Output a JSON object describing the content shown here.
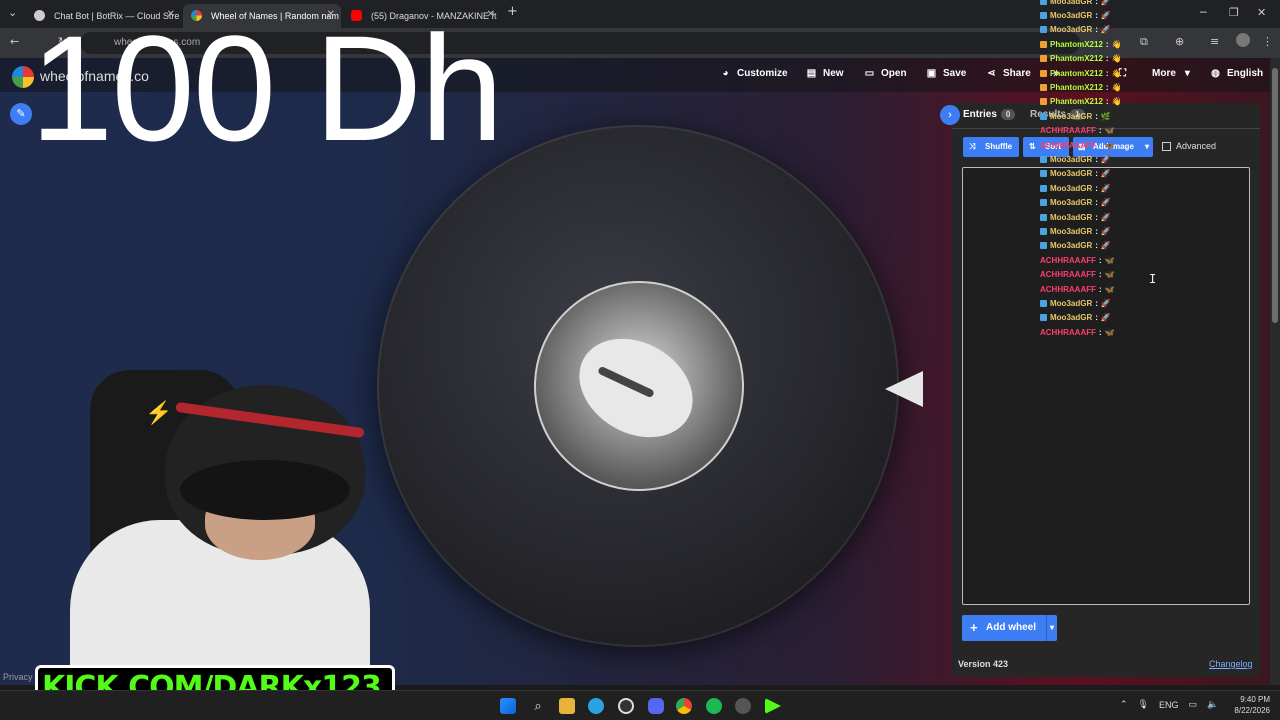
{
  "browser": {
    "tabs": [
      {
        "title": "Chat Bot | BotRix — Cloud Stre",
        "color": "#cccccc"
      },
      {
        "title": "Wheel of Names | Random nam",
        "color": "#e53935"
      },
      {
        "title": "(55) Draganov - MANZAKINE ft",
        "color": "#ff0000"
      }
    ],
    "new_tab": "+",
    "url": "wheelofnames.com"
  },
  "overlay": {
    "big_text": "100 Dh",
    "kick_banner": "KICK.COM/DARKx123"
  },
  "app": {
    "site_name": "wheelofnames.co",
    "toolbar": {
      "customize": "Customize",
      "new": "New",
      "open": "Open",
      "save": "Save",
      "share": "Share",
      "more": "More",
      "language": "English"
    },
    "panel": {
      "entries_tab": "Entries",
      "entries_count": "0",
      "results_tab": "Results",
      "results_count": "1",
      "shuffle": "Shuffle",
      "sort": "Sort",
      "add_image": "Add image",
      "advanced": "Advanced",
      "add_wheel": "Add wheel",
      "version": "Version 423",
      "changelog": "Changelog"
    },
    "privacy": "Privacy"
  },
  "chat": [
    {
      "user": "Moo3adGR",
      "color": "#e6c86b",
      "badge": "#4aa3df",
      "emote": "🚀"
    },
    {
      "user": "Moo3adGR",
      "color": "#e6c86b",
      "badge": "#4aa3df",
      "emote": "🚀"
    },
    {
      "user": "Moo3adGR",
      "color": "#e6c86b",
      "badge": "#4aa3df",
      "emote": "🚀"
    },
    {
      "user": "PhantomX212",
      "color": "#b4ff3c",
      "badge": "#f0a030",
      "emote": "👋"
    },
    {
      "user": "PhantomX212",
      "color": "#b4ff3c",
      "badge": "#f0a030",
      "emote": "👋"
    },
    {
      "user": "PhantomX212",
      "color": "#b4ff3c",
      "badge": "#f0a030",
      "emote": "👋"
    },
    {
      "user": "PhantomX212",
      "color": "#b4ff3c",
      "badge": "#f0a030",
      "emote": "👋"
    },
    {
      "user": "PhantomX212",
      "color": "#b4ff3c",
      "badge": "#f0a030",
      "emote": "👋"
    },
    {
      "user": "Moo3adGR",
      "color": "#e6c86b",
      "badge": "#4aa3df",
      "emote": "🌿"
    },
    {
      "user": "ACHHRAAAFF",
      "color": "#ff3d6e",
      "badge": "",
      "emote": "🦋"
    },
    {
      "user": "ACHHRAAAFF",
      "color": "#ff3d6e",
      "badge": "",
      "emote": "🦋"
    },
    {
      "user": "Moo3adGR",
      "color": "#e6c86b",
      "badge": "#4aa3df",
      "emote": "🚀"
    },
    {
      "user": "Moo3adGR",
      "color": "#e6c86b",
      "badge": "#4aa3df",
      "emote": "🚀"
    },
    {
      "user": "Moo3adGR",
      "color": "#e6c86b",
      "badge": "#4aa3df",
      "emote": "🚀"
    },
    {
      "user": "Moo3adGR",
      "color": "#e6c86b",
      "badge": "#4aa3df",
      "emote": "🚀"
    },
    {
      "user": "Moo3adGR",
      "color": "#e6c86b",
      "badge": "#4aa3df",
      "emote": "🚀"
    },
    {
      "user": "Moo3adGR",
      "color": "#e6c86b",
      "badge": "#4aa3df",
      "emote": "🚀"
    },
    {
      "user": "Moo3adGR",
      "color": "#e6c86b",
      "badge": "#4aa3df",
      "emote": "🚀"
    },
    {
      "user": "ACHHRAAAFF",
      "color": "#ff3d6e",
      "badge": "",
      "emote": "🦋"
    },
    {
      "user": "ACHHRAAAFF",
      "color": "#ff3d6e",
      "badge": "",
      "emote": "🦋"
    },
    {
      "user": "ACHHRAAAFF",
      "color": "#ff3d6e",
      "badge": "",
      "emote": "🦋"
    },
    {
      "user": "Moo3adGR",
      "color": "#e6c86b",
      "badge": "#4aa3df",
      "emote": "🚀"
    },
    {
      "user": "Moo3adGR",
      "color": "#e6c86b",
      "badge": "#4aa3df",
      "emote": "🚀"
    },
    {
      "user": "ACHHRAAAFF",
      "color": "#ff3d6e",
      "badge": "",
      "emote": "🦋"
    }
  ],
  "taskbar": {
    "lang": "ENG",
    "time": "9:40 PM",
    "date": "8/22/2026"
  },
  "colors": {
    "accent": "#3d7ef5",
    "kick_green": "#53fc18"
  }
}
